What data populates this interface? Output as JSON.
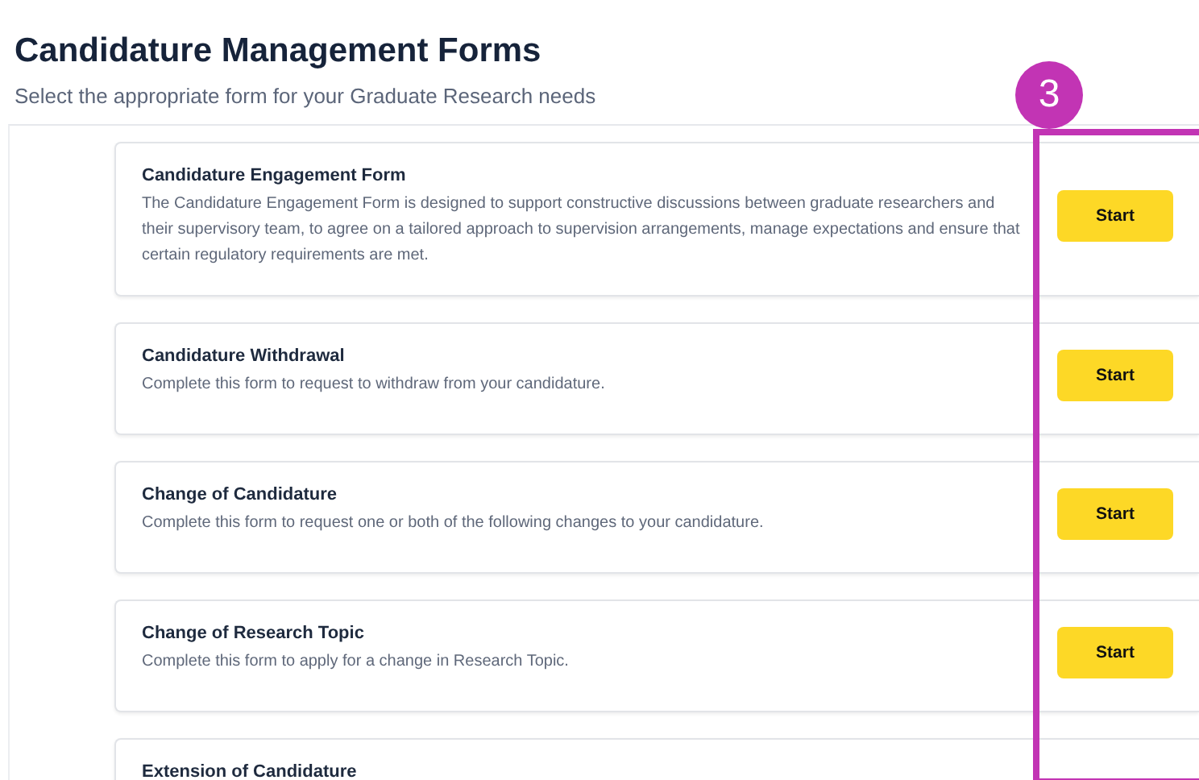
{
  "page": {
    "title": "Candidature Management Forms",
    "subtitle": "Select the appropriate form for your Graduate Research needs"
  },
  "forms": [
    {
      "title": "Candidature Engagement Form",
      "description": "The Candidature Engagement Form is designed to support constructive discussions between graduate researchers and their supervisory team, to agree on a tailored approach to supervision arrangements, manage expectations and ensure that certain regulatory requirements are met.",
      "button": "Start"
    },
    {
      "title": "Candidature Withdrawal",
      "description": "Complete this form to request to withdraw from your candidature.",
      "button": "Start"
    },
    {
      "title": "Change of Candidature",
      "description": "Complete this form to request one or both of the following changes to your candidature.",
      "button": "Start"
    },
    {
      "title": "Change of Research Topic",
      "description": "Complete this form to apply for a change in Research Topic.",
      "button": "Start"
    },
    {
      "title": "Extension of Candidature"
    }
  ],
  "annotation": {
    "label": "3"
  }
}
